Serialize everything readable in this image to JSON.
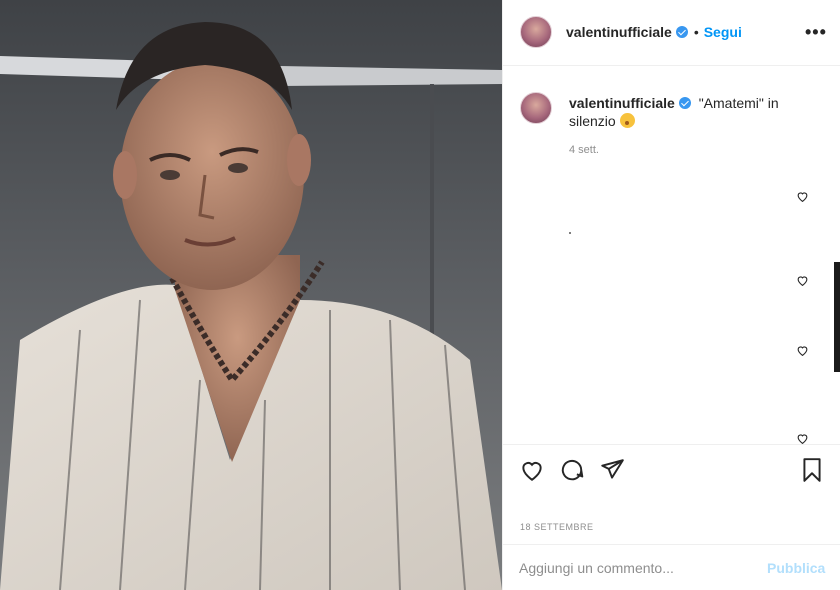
{
  "post": {
    "username": "valentinufficiale",
    "separator": "•",
    "follow_label": "Segui",
    "more_label": "•••",
    "caption_text": "\"Amatemi\" in silenzio",
    "caption_time": "4 sett.",
    "date": "18 settembre"
  },
  "comment_box": {
    "placeholder": "Aggiungi un commento...",
    "publish_label": "Pubblica"
  },
  "icons": {
    "like": "heart-icon",
    "comment": "comment-icon",
    "share": "paper-plane-icon",
    "save": "bookmark-icon",
    "verified": "verified-badge-icon",
    "menu": "more-options-icon"
  },
  "colors": {
    "link_blue": "#0095f6",
    "publish_disabled": "#b2dffc",
    "verified_blue": "#3897f0",
    "muted_text": "#8e8e8e"
  }
}
